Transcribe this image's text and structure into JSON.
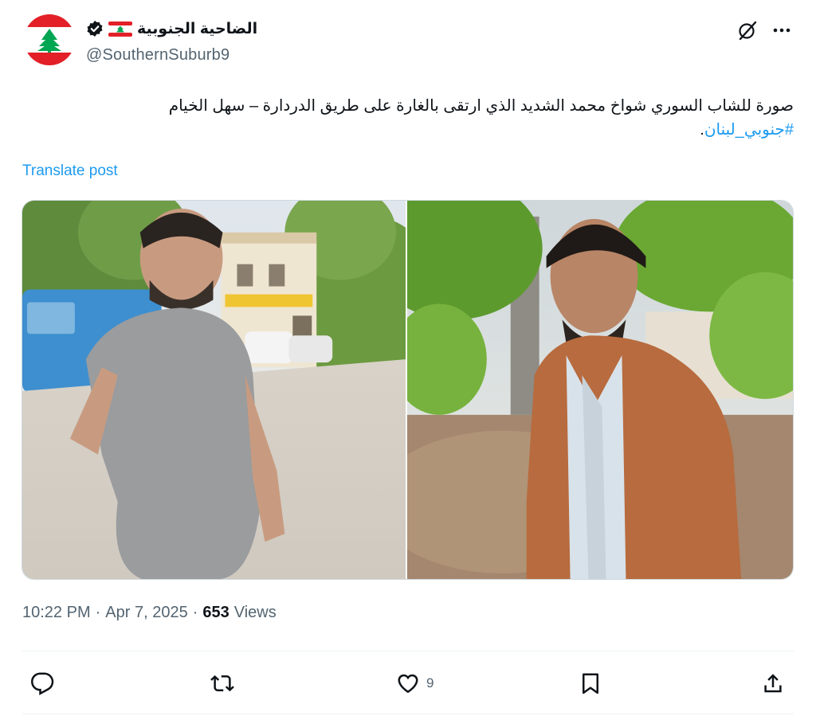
{
  "author": {
    "display_name": "الضاحية الجنوبية",
    "handle": "@SouthernSuburb9",
    "verified_icon": "verified-badge-icon",
    "flag_icon": "lebanon-flag-icon"
  },
  "header_actions": {
    "grok_icon": "grok-icon",
    "more_icon": "more-icon"
  },
  "tweet": {
    "text": "صورة للشاب السوري شواخ محمد الشديد الذي ارتقى بالغارة على طريق الدردارة – سهل الخيام",
    "hashtag": "#جنوبي_لبنان",
    "hashtag_suffix": ".",
    "translate_label": "Translate post"
  },
  "media": {
    "photo_count": 2
  },
  "meta": {
    "time": "10:22 PM",
    "separator1": "·",
    "date": "Apr 7, 2025",
    "separator2": "·",
    "views_count": "653",
    "views_label": "Views"
  },
  "actions": {
    "reply_count": "",
    "repost_count": "",
    "like_count": "9",
    "icons": [
      "reply-icon",
      "repost-icon",
      "like-icon",
      "bookmark-icon",
      "share-icon"
    ]
  },
  "colors": {
    "accent": "#1d9bf0",
    "text": "#0f1419",
    "secondary": "#536471",
    "border": "#cfd9de"
  }
}
